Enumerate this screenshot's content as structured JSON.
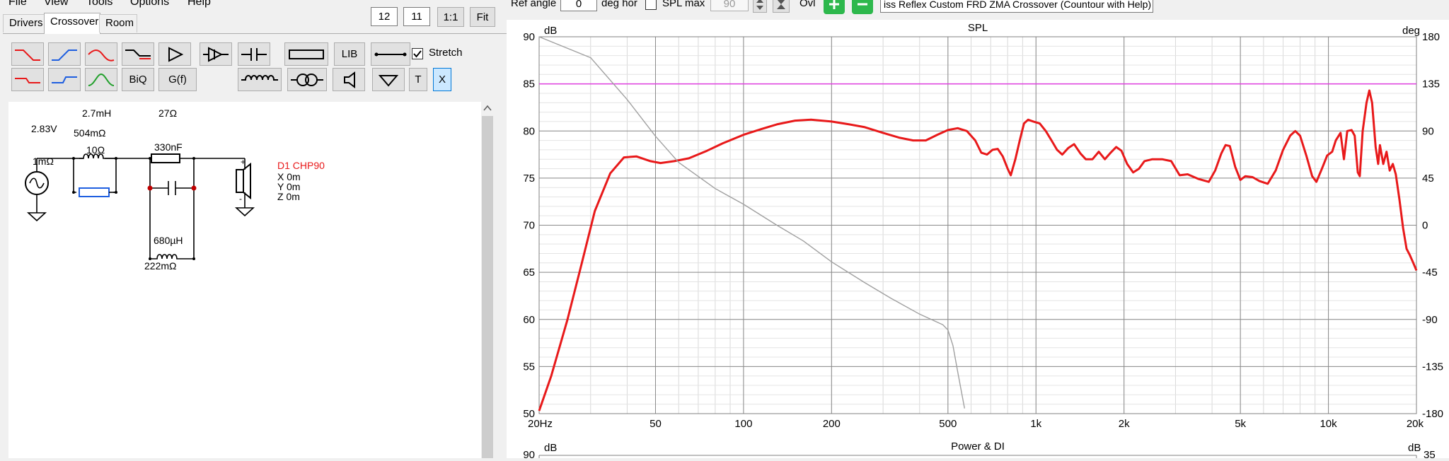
{
  "menu": [
    {
      "label": "File"
    },
    {
      "label": "View"
    },
    {
      "label": "Tools"
    },
    {
      "label": "Options"
    },
    {
      "label": "Help"
    }
  ],
  "tabs": [
    {
      "label": "Drivers"
    },
    {
      "label": "Crossover"
    },
    {
      "label": "Room"
    }
  ],
  "view_controls": {
    "width_value": "12",
    "height_value": "11",
    "one_to_one_label": "1:1",
    "fit_label": "Fit"
  },
  "toolbar": {
    "lib_label": "LIB",
    "biq_label": "BiQ",
    "gf_label": "G(f)",
    "t_label": "T",
    "x_label": "X",
    "stretch_label": "Stretch",
    "stretch_checked": true
  },
  "top_controls": {
    "ref_angle_label": "Ref angle",
    "ref_angle_value": "0",
    "deg_hor_label": "deg hor",
    "spl_max_label": "SPL max",
    "spl_max_value": "90",
    "ovl_label": "Ovl",
    "title_value": "iss Reflex Custom FRD ZMA Crossover (Countour with Help)"
  },
  "schematic": {
    "source_voltage": "2.83V",
    "source_resistance": "1mΩ",
    "inductor1_value": "2.7mH",
    "inductor1_resistance": "504mΩ",
    "resistor_parallel": "10Ω",
    "resistor_series": "27Ω",
    "capacitor_value": "330nF",
    "inductor2_value": "680µH",
    "inductor2_resistance": "222mΩ",
    "driver_name": "D1 CHP90",
    "driver_x": "X 0m",
    "driver_y": "Y 0m",
    "driver_z": "Z 0m",
    "plus_sign": "+",
    "minus_sign": "-"
  },
  "chart_data": [
    {
      "type": "line",
      "title": "SPL",
      "ylabel_left": "dB",
      "ylabel_right": "deg",
      "x_scale": "log",
      "xlim": [
        20,
        20000
      ],
      "ylim": [
        50,
        90
      ],
      "ylim_right": [
        -180,
        180
      ],
      "x_tick_labels": [
        "20Hz",
        "50",
        "100",
        "200",
        "500",
        "1k",
        "2k",
        "5k",
        "10k",
        "20k"
      ],
      "x_tick_values": [
        20,
        50,
        100,
        200,
        500,
        1000,
        2000,
        5000,
        10000,
        20000
      ],
      "y_tick_labels": [
        "90",
        "85",
        "80",
        "75",
        "70",
        "65",
        "60",
        "55",
        "50"
      ],
      "y_right_tick_labels": [
        "180",
        "135",
        "90",
        "45",
        "0",
        "-45",
        "-90",
        "-135",
        "-180"
      ],
      "grid": true,
      "reference_line": {
        "y": 85,
        "color": "#e040e0"
      },
      "series": [
        {
          "role": "spl",
          "color": "#e8191a",
          "points": [
            [
              20,
              50.3
            ],
            [
              22,
              54
            ],
            [
              25,
              60
            ],
            [
              28,
              66
            ],
            [
              31,
              71.5
            ],
            [
              35,
              75.5
            ],
            [
              39,
              77.2
            ],
            [
              43,
              77.3
            ],
            [
              48,
              76.8
            ],
            [
              52,
              76.6
            ],
            [
              58,
              76.8
            ],
            [
              65,
              77.1
            ],
            [
              75,
              77.9
            ],
            [
              85,
              78.7
            ],
            [
              100,
              79.6
            ],
            [
              115,
              80.2
            ],
            [
              130,
              80.7
            ],
            [
              150,
              81.1
            ],
            [
              170,
              81.2
            ],
            [
              200,
              81
            ],
            [
              230,
              80.7
            ],
            [
              260,
              80.4
            ],
            [
              300,
              79.8
            ],
            [
              340,
              79.3
            ],
            [
              380,
              79
            ],
            [
              420,
              79
            ],
            [
              460,
              79.6
            ],
            [
              500,
              80.1
            ],
            [
              540,
              80.3
            ],
            [
              580,
              80
            ],
            [
              620,
              79
            ],
            [
              650,
              77.7
            ],
            [
              680,
              77.5
            ],
            [
              710,
              78
            ],
            [
              740,
              78.1
            ],
            [
              770,
              77.3
            ],
            [
              800,
              76
            ],
            [
              820,
              75.3
            ],
            [
              850,
              77
            ],
            [
              880,
              79
            ],
            [
              910,
              80.8
            ],
            [
              940,
              81.2
            ],
            [
              980,
              81
            ],
            [
              1030,
              80.8
            ],
            [
              1080,
              80
            ],
            [
              1130,
              79
            ],
            [
              1180,
              78
            ],
            [
              1230,
              77.5
            ],
            [
              1290,
              78.2
            ],
            [
              1350,
              78.6
            ],
            [
              1420,
              77.6
            ],
            [
              1480,
              77
            ],
            [
              1560,
              77
            ],
            [
              1640,
              77.8
            ],
            [
              1720,
              77
            ],
            [
              1800,
              77.7
            ],
            [
              1880,
              78.3
            ],
            [
              1960,
              77.9
            ],
            [
              2050,
              76.5
            ],
            [
              2150,
              75.6
            ],
            [
              2250,
              76
            ],
            [
              2350,
              76.8
            ],
            [
              2500,
              77
            ],
            [
              2700,
              77
            ],
            [
              2900,
              76.8
            ],
            [
              3100,
              75.3
            ],
            [
              3300,
              75.4
            ],
            [
              3600,
              74.9
            ],
            [
              3900,
              74.6
            ],
            [
              4100,
              75.8
            ],
            [
              4300,
              77.6
            ],
            [
              4450,
              78.5
            ],
            [
              4600,
              78.4
            ],
            [
              4800,
              76.2
            ],
            [
              5000,
              74.8
            ],
            [
              5200,
              75.2
            ],
            [
              5500,
              75.1
            ],
            [
              5800,
              74.7
            ],
            [
              6200,
              74.4
            ],
            [
              6600,
              75.8
            ],
            [
              7000,
              78
            ],
            [
              7400,
              79.5
            ],
            [
              7700,
              80
            ],
            [
              8000,
              79.5
            ],
            [
              8400,
              77.4
            ],
            [
              8800,
              75.2
            ],
            [
              9100,
              74.6
            ],
            [
              9500,
              76
            ],
            [
              9900,
              77.4
            ],
            [
              10300,
              77.8
            ],
            [
              10600,
              79
            ],
            [
              11000,
              79.8
            ],
            [
              11300,
              77
            ],
            [
              11600,
              80
            ],
            [
              12000,
              80.1
            ],
            [
              12300,
              79.5
            ],
            [
              12600,
              75.6
            ],
            [
              12800,
              75.2
            ],
            [
              13100,
              80
            ],
            [
              13500,
              83
            ],
            [
              13800,
              84.3
            ],
            [
              14100,
              83
            ],
            [
              14500,
              78.3
            ],
            [
              14800,
              76.5
            ],
            [
              15000,
              78.5
            ],
            [
              15400,
              76.5
            ],
            [
              15800,
              77.8
            ],
            [
              16200,
              75.8
            ],
            [
              16600,
              76.5
            ],
            [
              17000,
              75.4
            ],
            [
              17500,
              72.7
            ],
            [
              18000,
              69.7
            ],
            [
              18500,
              67.5
            ],
            [
              19000,
              66.8
            ],
            [
              19500,
              66
            ],
            [
              20000,
              65.2
            ]
          ]
        },
        {
          "role": "phase",
          "color": "#a0a0a0",
          "axis": "right",
          "points": [
            [
              20,
              180
            ],
            [
              30,
              160
            ],
            [
              40,
              120
            ],
            [
              50,
              85
            ],
            [
              60,
              60
            ],
            [
              80,
              35
            ],
            [
              100,
              20
            ],
            [
              130,
              0
            ],
            [
              160,
              -15
            ],
            [
              200,
              -35
            ],
            [
              260,
              -55
            ],
            [
              320,
              -70
            ],
            [
              400,
              -85
            ],
            [
              480,
              -95
            ],
            [
              500,
              -100
            ],
            [
              520,
              -115
            ],
            [
              540,
              -140
            ],
            [
              570,
              -175
            ]
          ]
        }
      ]
    },
    {
      "type": "line",
      "title": "Power & DI",
      "ylabel_left": "dB",
      "ylabel_right": "dB",
      "y_tick_labels": [
        "90"
      ],
      "y_right_tick_labels": [
        "35"
      ]
    }
  ]
}
